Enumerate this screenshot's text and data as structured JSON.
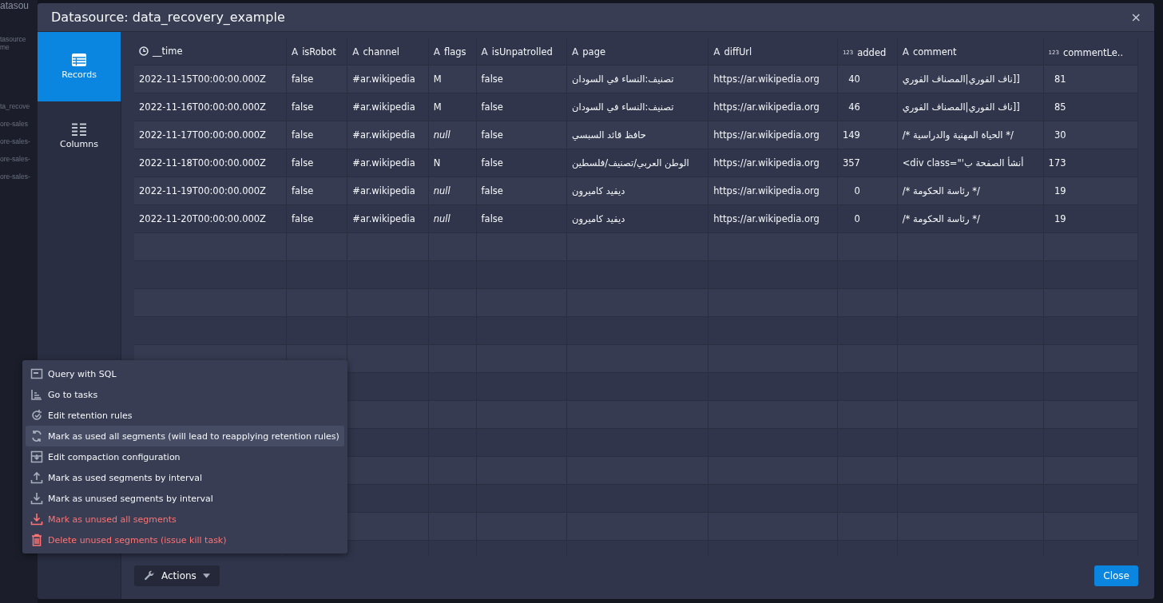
{
  "backdrop": {
    "texts": [
      "atasou",
      "tasource",
      "me",
      "ta_recove",
      "ore-sales",
      "ore-sales-",
      "ore-sales-",
      "ore-sales-"
    ]
  },
  "dialog": {
    "title": "Datasource: data_recovery_example",
    "close_glyph": "×"
  },
  "sidebar": {
    "items": [
      {
        "label": "Records",
        "kind": "table",
        "selected": true
      },
      {
        "label": "Columns",
        "kind": "columns",
        "selected": false
      }
    ]
  },
  "table": {
    "columns": [
      {
        "label": "__time",
        "kind": "time"
      },
      {
        "label": "isRobot",
        "kind": "string",
        "icon": "A"
      },
      {
        "label": "channel",
        "kind": "string",
        "icon": "A"
      },
      {
        "label": "flags",
        "kind": "string",
        "icon": "A"
      },
      {
        "label": "isUnpatrolled",
        "kind": "string",
        "icon": "A"
      },
      {
        "label": "page",
        "kind": "string",
        "icon": "A"
      },
      {
        "label": "diffUrl",
        "kind": "string",
        "icon": "A"
      },
      {
        "label": "added",
        "kind": "number",
        "icon": "123"
      },
      {
        "label": "comment",
        "kind": "string",
        "icon": "A"
      },
      {
        "label": "commentLe..",
        "kind": "number",
        "icon": "123"
      }
    ],
    "rows": [
      [
        "2022-11-15T00:00:00.000Z",
        "false",
        "#ar.wikipedia",
        "M",
        "false",
        "تصنيف:النساء في السودان",
        "https://ar.wikipedia.org",
        "40",
        "ناف الفوري|المصناف الفوري]]",
        "81"
      ],
      [
        "2022-11-16T00:00:00.000Z",
        "false",
        "#ar.wikipedia",
        "M",
        "false",
        "تصنيف:النساء في السودان",
        "https://ar.wikipedia.org",
        "46",
        "ناف الفوري|المصناف الفوري]]",
        "85"
      ],
      [
        "2022-11-17T00:00:00.000Z",
        "false",
        "#ar.wikipedia",
        {
          "text": "null",
          "null": true
        },
        "false",
        "حافظ قائد السبسي",
        "https://ar.wikipedia.org",
        "149",
        "/* الحياة المهنية والدراسية */",
        "30"
      ],
      [
        "2022-11-18T00:00:00.000Z",
        "false",
        "#ar.wikipedia",
        "N",
        "false",
        "الوطن العربي/تصنيف/فلسطين",
        "https://ar.wikipedia.org",
        "357",
        "<div class=\"'أنشأ الصفحة ب",
        "173"
      ],
      [
        "2022-11-19T00:00:00.000Z",
        "false",
        "#ar.wikipedia",
        {
          "text": "null",
          "null": true
        },
        "false",
        "ديفيد كاميرون",
        "https://ar.wikipedia.org",
        "0",
        "/* رئاسة الحكومة */",
        "19"
      ],
      [
        "2022-11-20T00:00:00.000Z",
        "false",
        "#ar.wikipedia",
        {
          "text": "null",
          "null": true
        },
        "false",
        "ديفيد كاميرون",
        "https://ar.wikipedia.org",
        "0",
        "/* رئاسة الحكومة */",
        "19"
      ]
    ]
  },
  "menu": {
    "items": [
      {
        "label": "Query with SQL",
        "kind": "sql",
        "danger": false,
        "selected": false
      },
      {
        "label": "Go to tasks",
        "kind": "tasks",
        "danger": false,
        "selected": false
      },
      {
        "label": "Edit retention rules",
        "kind": "retention",
        "danger": false,
        "selected": false
      },
      {
        "label": "Mark as used all segments (will lead to reapplying retention rules)",
        "kind": "refresh",
        "danger": false,
        "selected": true
      },
      {
        "label": "Edit compaction configuration",
        "kind": "compaction",
        "danger": false,
        "selected": false
      },
      {
        "label": "Mark as used segments by interval",
        "kind": "upload",
        "danger": false,
        "selected": false
      },
      {
        "label": "Mark as unused segments by interval",
        "kind": "download",
        "danger": false,
        "selected": false
      },
      {
        "label": "Mark as unused all segments",
        "kind": "download",
        "danger": true,
        "selected": false
      },
      {
        "label": "Delete unused segments (issue kill task)",
        "kind": "trash",
        "danger": true,
        "selected": false
      }
    ]
  },
  "footer": {
    "actions_button": "Actions",
    "close_button": "Close"
  }
}
